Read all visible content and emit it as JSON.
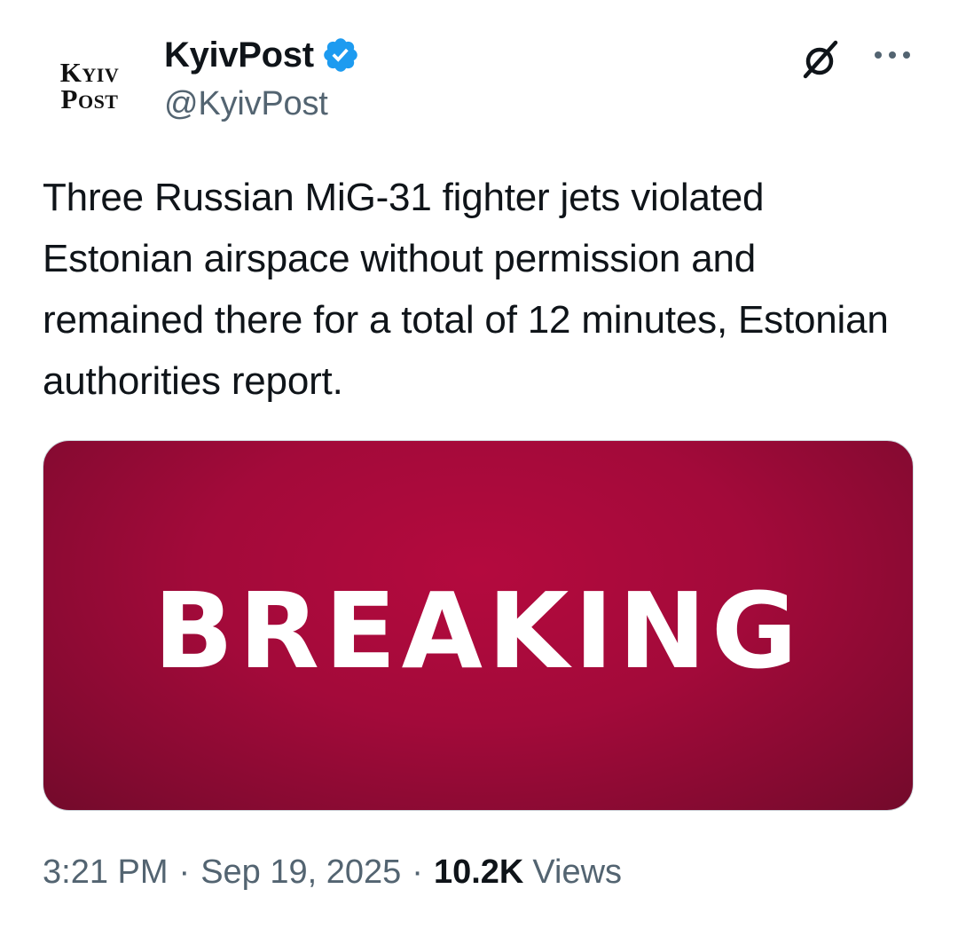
{
  "author": {
    "logo_line_1": "Kyiv",
    "logo_line_2": "Post",
    "display_name": "KyivPost",
    "handle": "@KyivPost",
    "verified_color": "#1d9bf0"
  },
  "tweet": {
    "text": "Three Russian MiG-31 fighter jets violated Estonian airspace without permission and remained there for a total of 12 minutes, Estonian authorities report."
  },
  "media": {
    "text": "BREAKING",
    "background_color": "#a30a3a"
  },
  "meta": {
    "time": "3:21 PM",
    "separator": "·",
    "date": "Sep 19, 2025",
    "views_count": "10.2K",
    "views_label": "Views"
  },
  "icons": {
    "grok": "grok-icon",
    "more": "more-icon",
    "verified": "verified-badge-icon"
  }
}
